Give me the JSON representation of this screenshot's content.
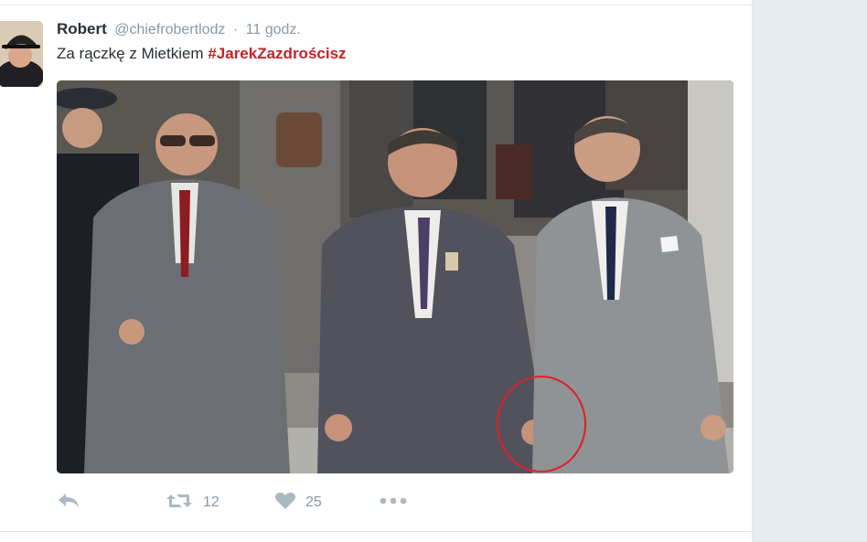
{
  "tweet": {
    "author_name": "Robert",
    "author_handle": "@chiefrobertlodz",
    "separator": "·",
    "time": "11 godz.",
    "text_plain": "Za rączkę z Mietkiem",
    "hashtag": "#JarekZazdrościsz"
  },
  "actions": {
    "retweet_count": "12",
    "like_count": "25"
  },
  "icons": {
    "reply": "reply-icon",
    "retweet": "retweet-icon",
    "like": "heart-icon",
    "more": "more-dots-icon"
  },
  "colors": {
    "hashtag": "#c32226",
    "meta": "#8899a6",
    "action_icon": "#aab8c2",
    "annotation_circle": "#e0202a"
  }
}
